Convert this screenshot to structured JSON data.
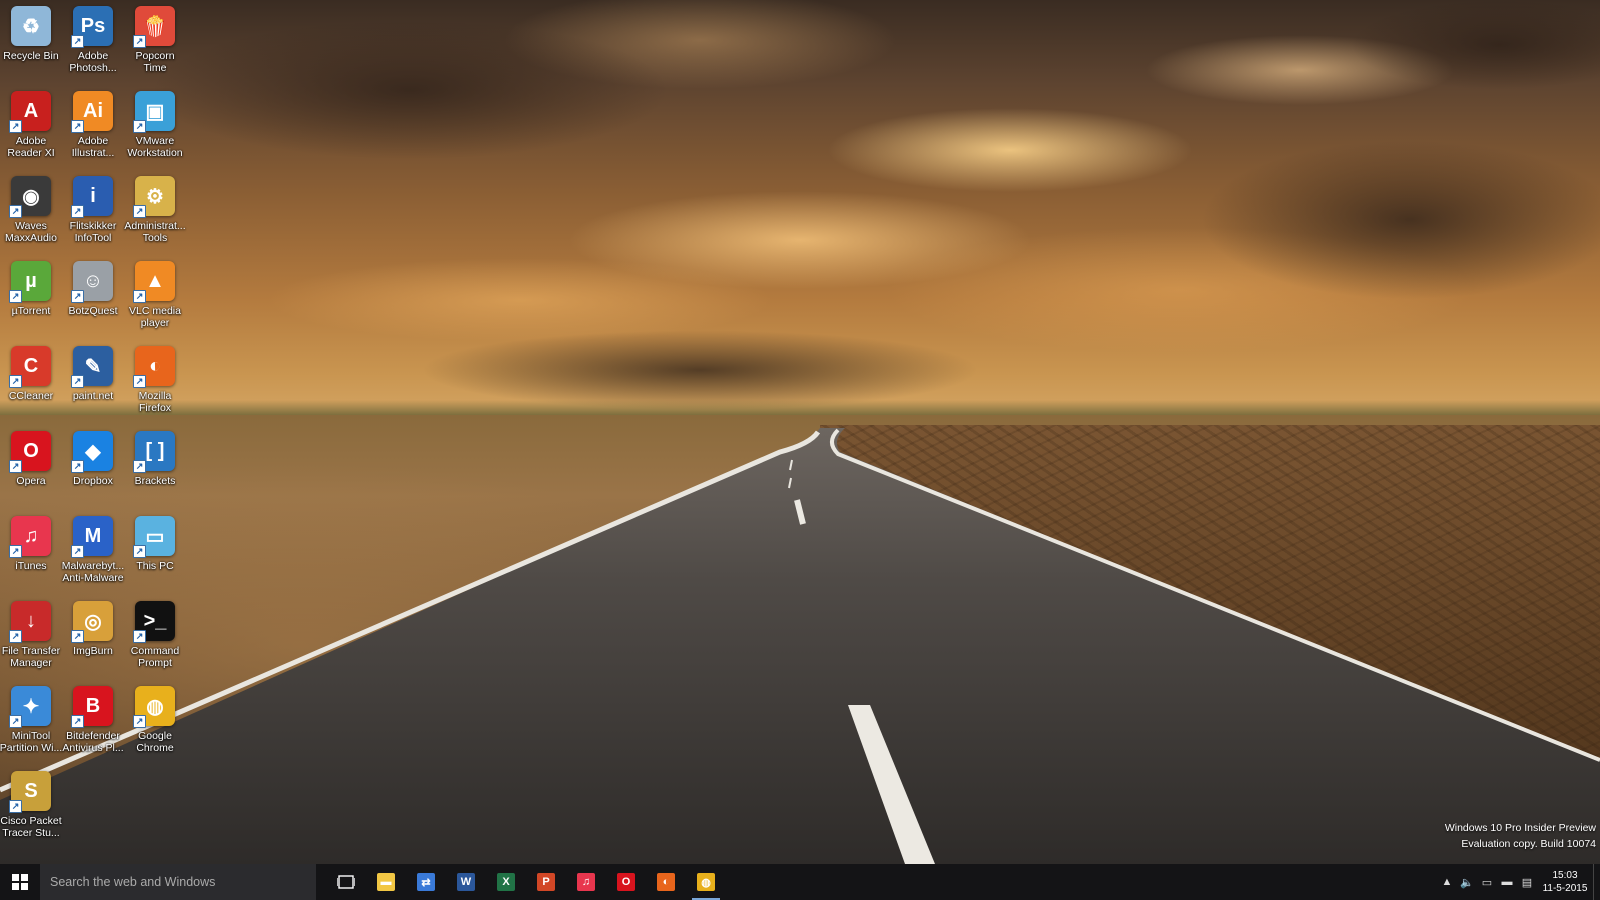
{
  "desktop": {
    "icons": [
      {
        "label": "Recycle Bin",
        "icon": "recycle-bin-icon",
        "color": "#8fb7d8",
        "glyph": "♻",
        "shortcut": false
      },
      {
        "label": "Adobe\nPhotosh...",
        "icon": "adobe-photoshop-icon",
        "color": "#2b6fb4",
        "glyph": "Ps",
        "shortcut": true
      },
      {
        "label": "Popcorn\nTime",
        "icon": "popcorn-time-icon",
        "color": "#e04a3a",
        "glyph": "🍿",
        "shortcut": true
      },
      {
        "label": "Adobe\nReader XI",
        "icon": "adobe-reader-icon",
        "color": "#c8201e",
        "glyph": "A",
        "shortcut": true
      },
      {
        "label": "Adobe\nIllustrat...",
        "icon": "adobe-illustrator-icon",
        "color": "#f08a24",
        "glyph": "Ai",
        "shortcut": true
      },
      {
        "label": "VMware\nWorkstation",
        "icon": "vmware-workstation-icon",
        "color": "#3aa0d8",
        "glyph": "▣",
        "shortcut": true
      },
      {
        "label": "Waves\nMaxxAudio",
        "icon": "waves-maxxaudio-icon",
        "color": "#3a3a3a",
        "glyph": "◉",
        "shortcut": true
      },
      {
        "label": "Flitskikker\nInfoTool",
        "icon": "flitskikker-infotool-icon",
        "color": "#2a5db0",
        "glyph": "i",
        "shortcut": true
      },
      {
        "label": "Administrat...\nTools",
        "icon": "administrative-tools-icon",
        "color": "#d8b24a",
        "glyph": "⚙",
        "shortcut": true
      },
      {
        "label": "µTorrent",
        "icon": "utorrent-icon",
        "color": "#5aa83a",
        "glyph": "µ",
        "shortcut": true
      },
      {
        "label": "BotzQuest",
        "icon": "botzquest-icon",
        "color": "#9aa0a6",
        "glyph": "☺",
        "shortcut": true
      },
      {
        "label": "VLC media\nplayer",
        "icon": "vlc-icon",
        "color": "#f08a24",
        "glyph": "▲",
        "shortcut": true
      },
      {
        "label": "CCleaner",
        "icon": "ccleaner-icon",
        "color": "#d83a2a",
        "glyph": "C",
        "shortcut": true
      },
      {
        "label": "paint.net",
        "icon": "paint-net-icon",
        "color": "#2c5fa0",
        "glyph": "✎",
        "shortcut": true
      },
      {
        "label": "Mozilla\nFirefox",
        "icon": "firefox-icon",
        "color": "#e8651c",
        "glyph": "◐",
        "shortcut": true
      },
      {
        "label": "Opera",
        "icon": "opera-icon",
        "color": "#d8141e",
        "glyph": "O",
        "shortcut": true
      },
      {
        "label": "Dropbox",
        "icon": "dropbox-icon",
        "color": "#1a82e2",
        "glyph": "◆",
        "shortcut": true
      },
      {
        "label": "Brackets",
        "icon": "brackets-icon",
        "color": "#2a78c2",
        "glyph": "[ ]",
        "shortcut": true
      },
      {
        "label": "iTunes",
        "icon": "itunes-icon",
        "color": "#e8364e",
        "glyph": "♫",
        "shortcut": true
      },
      {
        "label": "Malwarebyt...\nAnti-Malware",
        "icon": "malwarebytes-icon",
        "color": "#2a62c8",
        "glyph": "M",
        "shortcut": true
      },
      {
        "label": "This PC",
        "icon": "this-pc-icon",
        "color": "#5ab2e0",
        "glyph": "▭",
        "shortcut": true
      },
      {
        "label": "File Transfer\nManager",
        "icon": "file-transfer-manager-icon",
        "color": "#c82a2a",
        "glyph": "↓",
        "shortcut": true
      },
      {
        "label": "ImgBurn",
        "icon": "imgburn-icon",
        "color": "#d8a03a",
        "glyph": "◎",
        "shortcut": true
      },
      {
        "label": "Command\nPrompt",
        "icon": "command-prompt-icon",
        "color": "#111111",
        "glyph": ">_",
        "shortcut": true
      },
      {
        "label": "MiniTool\nPartition Wi...",
        "icon": "minitool-partition-wizard-icon",
        "color": "#3a8ad8",
        "glyph": "✦",
        "shortcut": true
      },
      {
        "label": "Bitdefender\nAntivirus Pl...",
        "icon": "bitdefender-icon",
        "color": "#d8141e",
        "glyph": "B",
        "shortcut": true
      },
      {
        "label": "Google\nChrome",
        "icon": "chrome-icon",
        "color": "#e8b01c",
        "glyph": "◍",
        "shortcut": true
      },
      {
        "label": "Cisco Packet\nTracer Stu...",
        "icon": "cisco-packet-tracer-icon",
        "color": "#c8a03a",
        "glyph": "S",
        "shortcut": true
      }
    ]
  },
  "watermark": {
    "line1": "Windows 10 Pro Insider Preview",
    "line2": "Evaluation copy. Build 10074"
  },
  "taskbar": {
    "search_placeholder": "Search the web and Windows",
    "apps": [
      {
        "name": "file-explorer",
        "icon": "file-explorer-icon",
        "color": "#f2c744",
        "glyph": "▬"
      },
      {
        "name": "network-connections",
        "icon": "network-icon",
        "color": "#3a7ad8",
        "glyph": "⇄"
      },
      {
        "name": "word",
        "icon": "word-icon",
        "color": "#2b579a",
        "glyph": "W"
      },
      {
        "name": "excel",
        "icon": "excel-icon",
        "color": "#217346",
        "glyph": "X"
      },
      {
        "name": "powerpoint",
        "icon": "powerpoint-icon",
        "color": "#d24726",
        "glyph": "P"
      },
      {
        "name": "itunes",
        "icon": "itunes-icon",
        "color": "#e8364e",
        "glyph": "♫"
      },
      {
        "name": "opera",
        "icon": "opera-icon",
        "color": "#d8141e",
        "glyph": "O"
      },
      {
        "name": "firefox",
        "icon": "firefox-icon",
        "color": "#e8651c",
        "glyph": "◐"
      },
      {
        "name": "chrome",
        "icon": "chrome-icon",
        "color": "#e8b01c",
        "glyph": "◍",
        "active": true
      }
    ],
    "clock": {
      "time": "15:03",
      "date": "11-5-2015"
    }
  }
}
